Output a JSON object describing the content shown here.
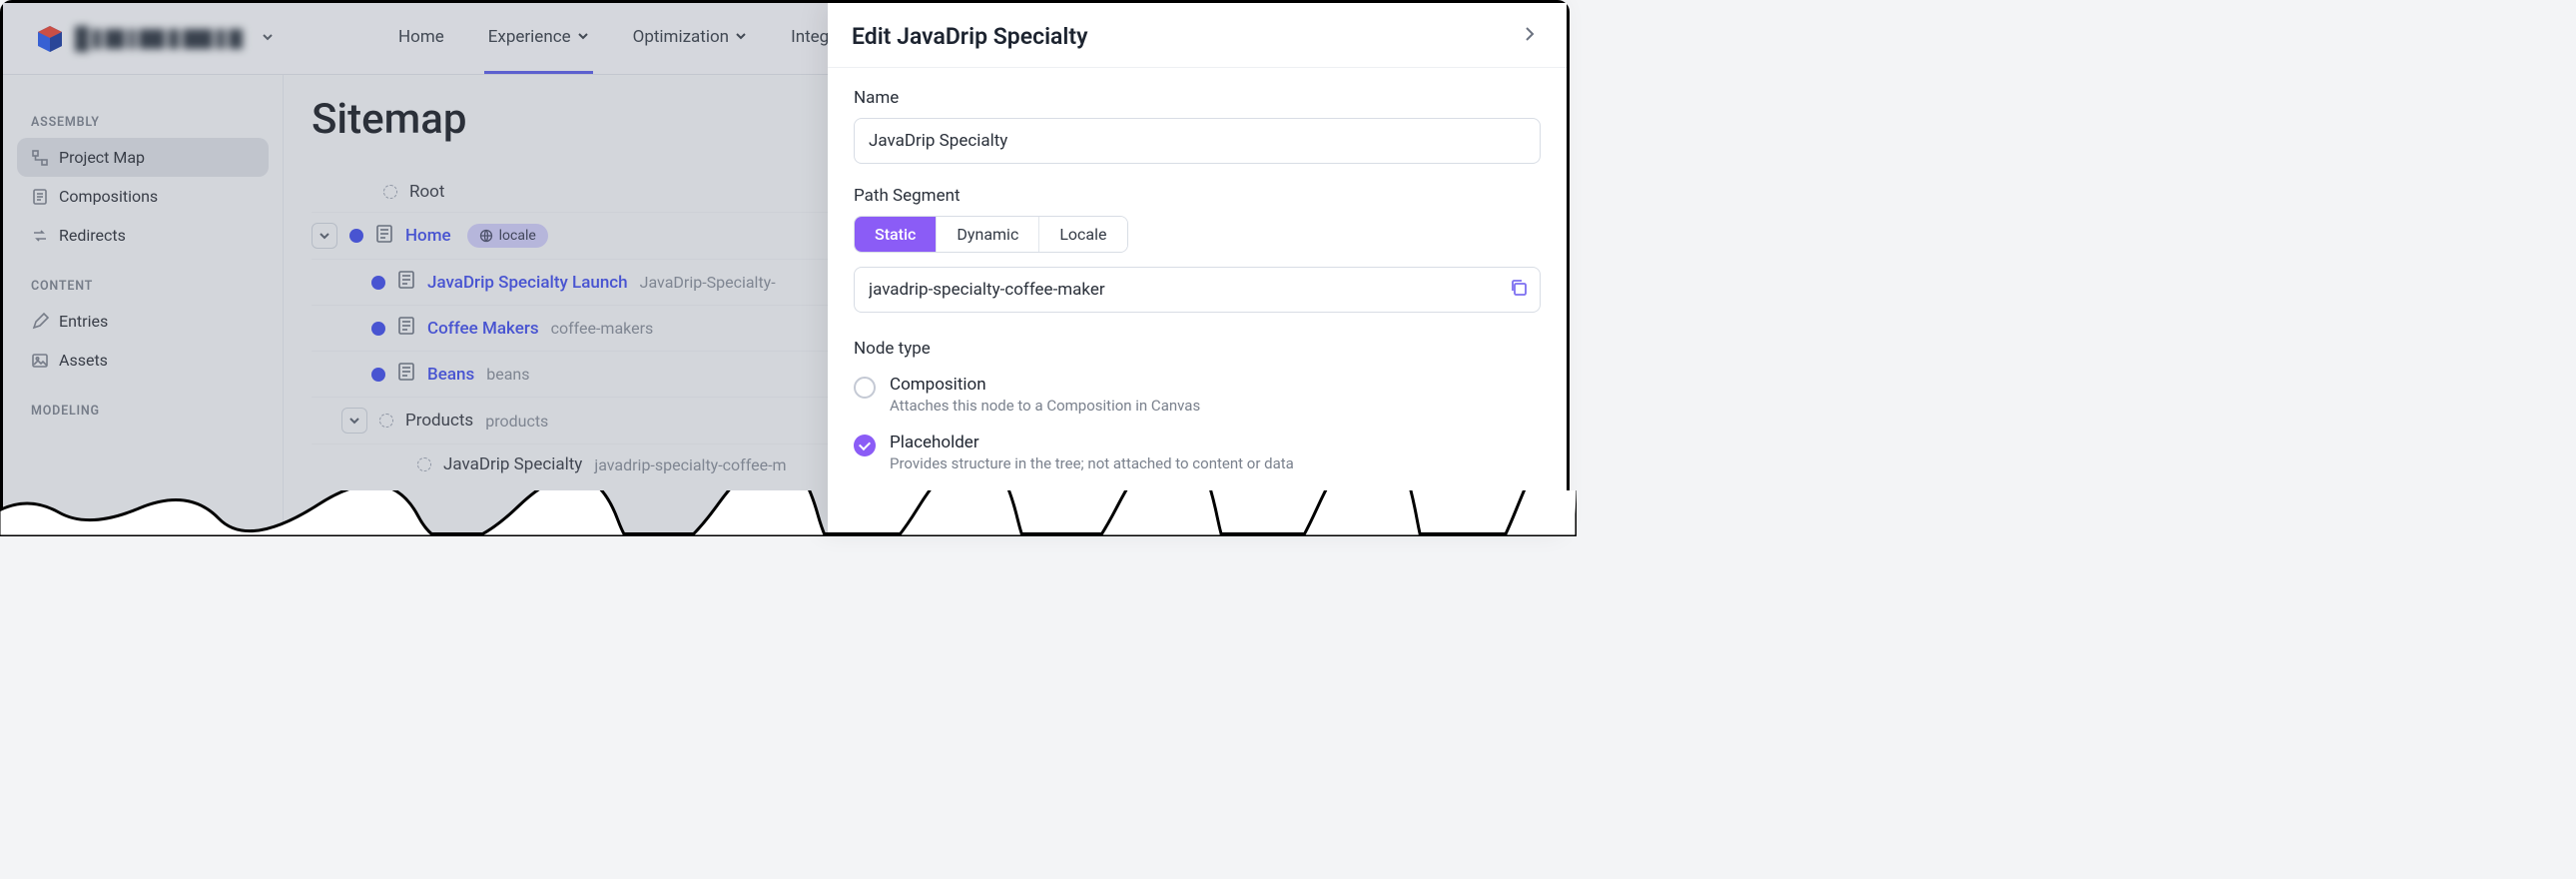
{
  "nav": {
    "items": [
      {
        "label": "Home",
        "active": false
      },
      {
        "label": "Experience",
        "active": true
      },
      {
        "label": "Optimization",
        "active": false
      },
      {
        "label": "Integrations",
        "active": false
      }
    ]
  },
  "sidebar": {
    "groups": [
      {
        "heading": "ASSEMBLY",
        "items": [
          {
            "label": "Project Map",
            "active": true,
            "icon": "tree"
          },
          {
            "label": "Compositions",
            "active": false,
            "icon": "doc"
          },
          {
            "label": "Redirects",
            "active": false,
            "icon": "redirect"
          }
        ]
      },
      {
        "heading": "CONTENT",
        "items": [
          {
            "label": "Entries",
            "active": false,
            "icon": "pencil"
          },
          {
            "label": "Assets",
            "active": false,
            "icon": "image"
          }
        ]
      },
      {
        "heading": "MODELING",
        "items": []
      }
    ]
  },
  "page": {
    "title": "Sitemap"
  },
  "tree": [
    {
      "level": 0,
      "name": "Root",
      "slug": "",
      "filled": false,
      "link": false,
      "expander": false,
      "locale": false
    },
    {
      "level": 1,
      "name": "Home",
      "slug": "",
      "filled": true,
      "link": true,
      "expander": true,
      "locale": true
    },
    {
      "level": 2,
      "name": "JavaDrip Specialty Launch",
      "slug": "JavaDrip-Specialty-",
      "filled": true,
      "link": true,
      "expander": false,
      "locale": false
    },
    {
      "level": 2,
      "name": "Coffee Makers",
      "slug": "coffee-makers",
      "filled": true,
      "link": true,
      "expander": false,
      "locale": false
    },
    {
      "level": 2,
      "name": "Beans",
      "slug": "beans",
      "filled": true,
      "link": true,
      "expander": false,
      "locale": false
    },
    {
      "level": 2,
      "name": "Products",
      "slug": "products",
      "filled": false,
      "link": false,
      "expander": true,
      "locale": false
    },
    {
      "level": 2,
      "name": "JavaDrip Specialty",
      "slug": "javadrip-specialty-coffee-m",
      "filled": false,
      "link": false,
      "expander": false,
      "locale": false
    }
  ],
  "locale_badge": "locale",
  "panel": {
    "title": "Edit JavaDrip Specialty",
    "fields": {
      "name_label": "Name",
      "name_value": "JavaDrip Specialty",
      "path_label": "Path Segment",
      "path_value": "javadrip-specialty-coffee-maker",
      "segments": [
        "Static",
        "Dynamic",
        "Locale"
      ],
      "segment_active": "Static",
      "nodetype_label": "Node type",
      "options": [
        {
          "title": "Composition",
          "desc": "Attaches this node to a Composition in Canvas",
          "checked": false
        },
        {
          "title": "Placeholder",
          "desc": "Provides structure in the tree; not attached to content or data",
          "checked": true
        }
      ]
    }
  }
}
